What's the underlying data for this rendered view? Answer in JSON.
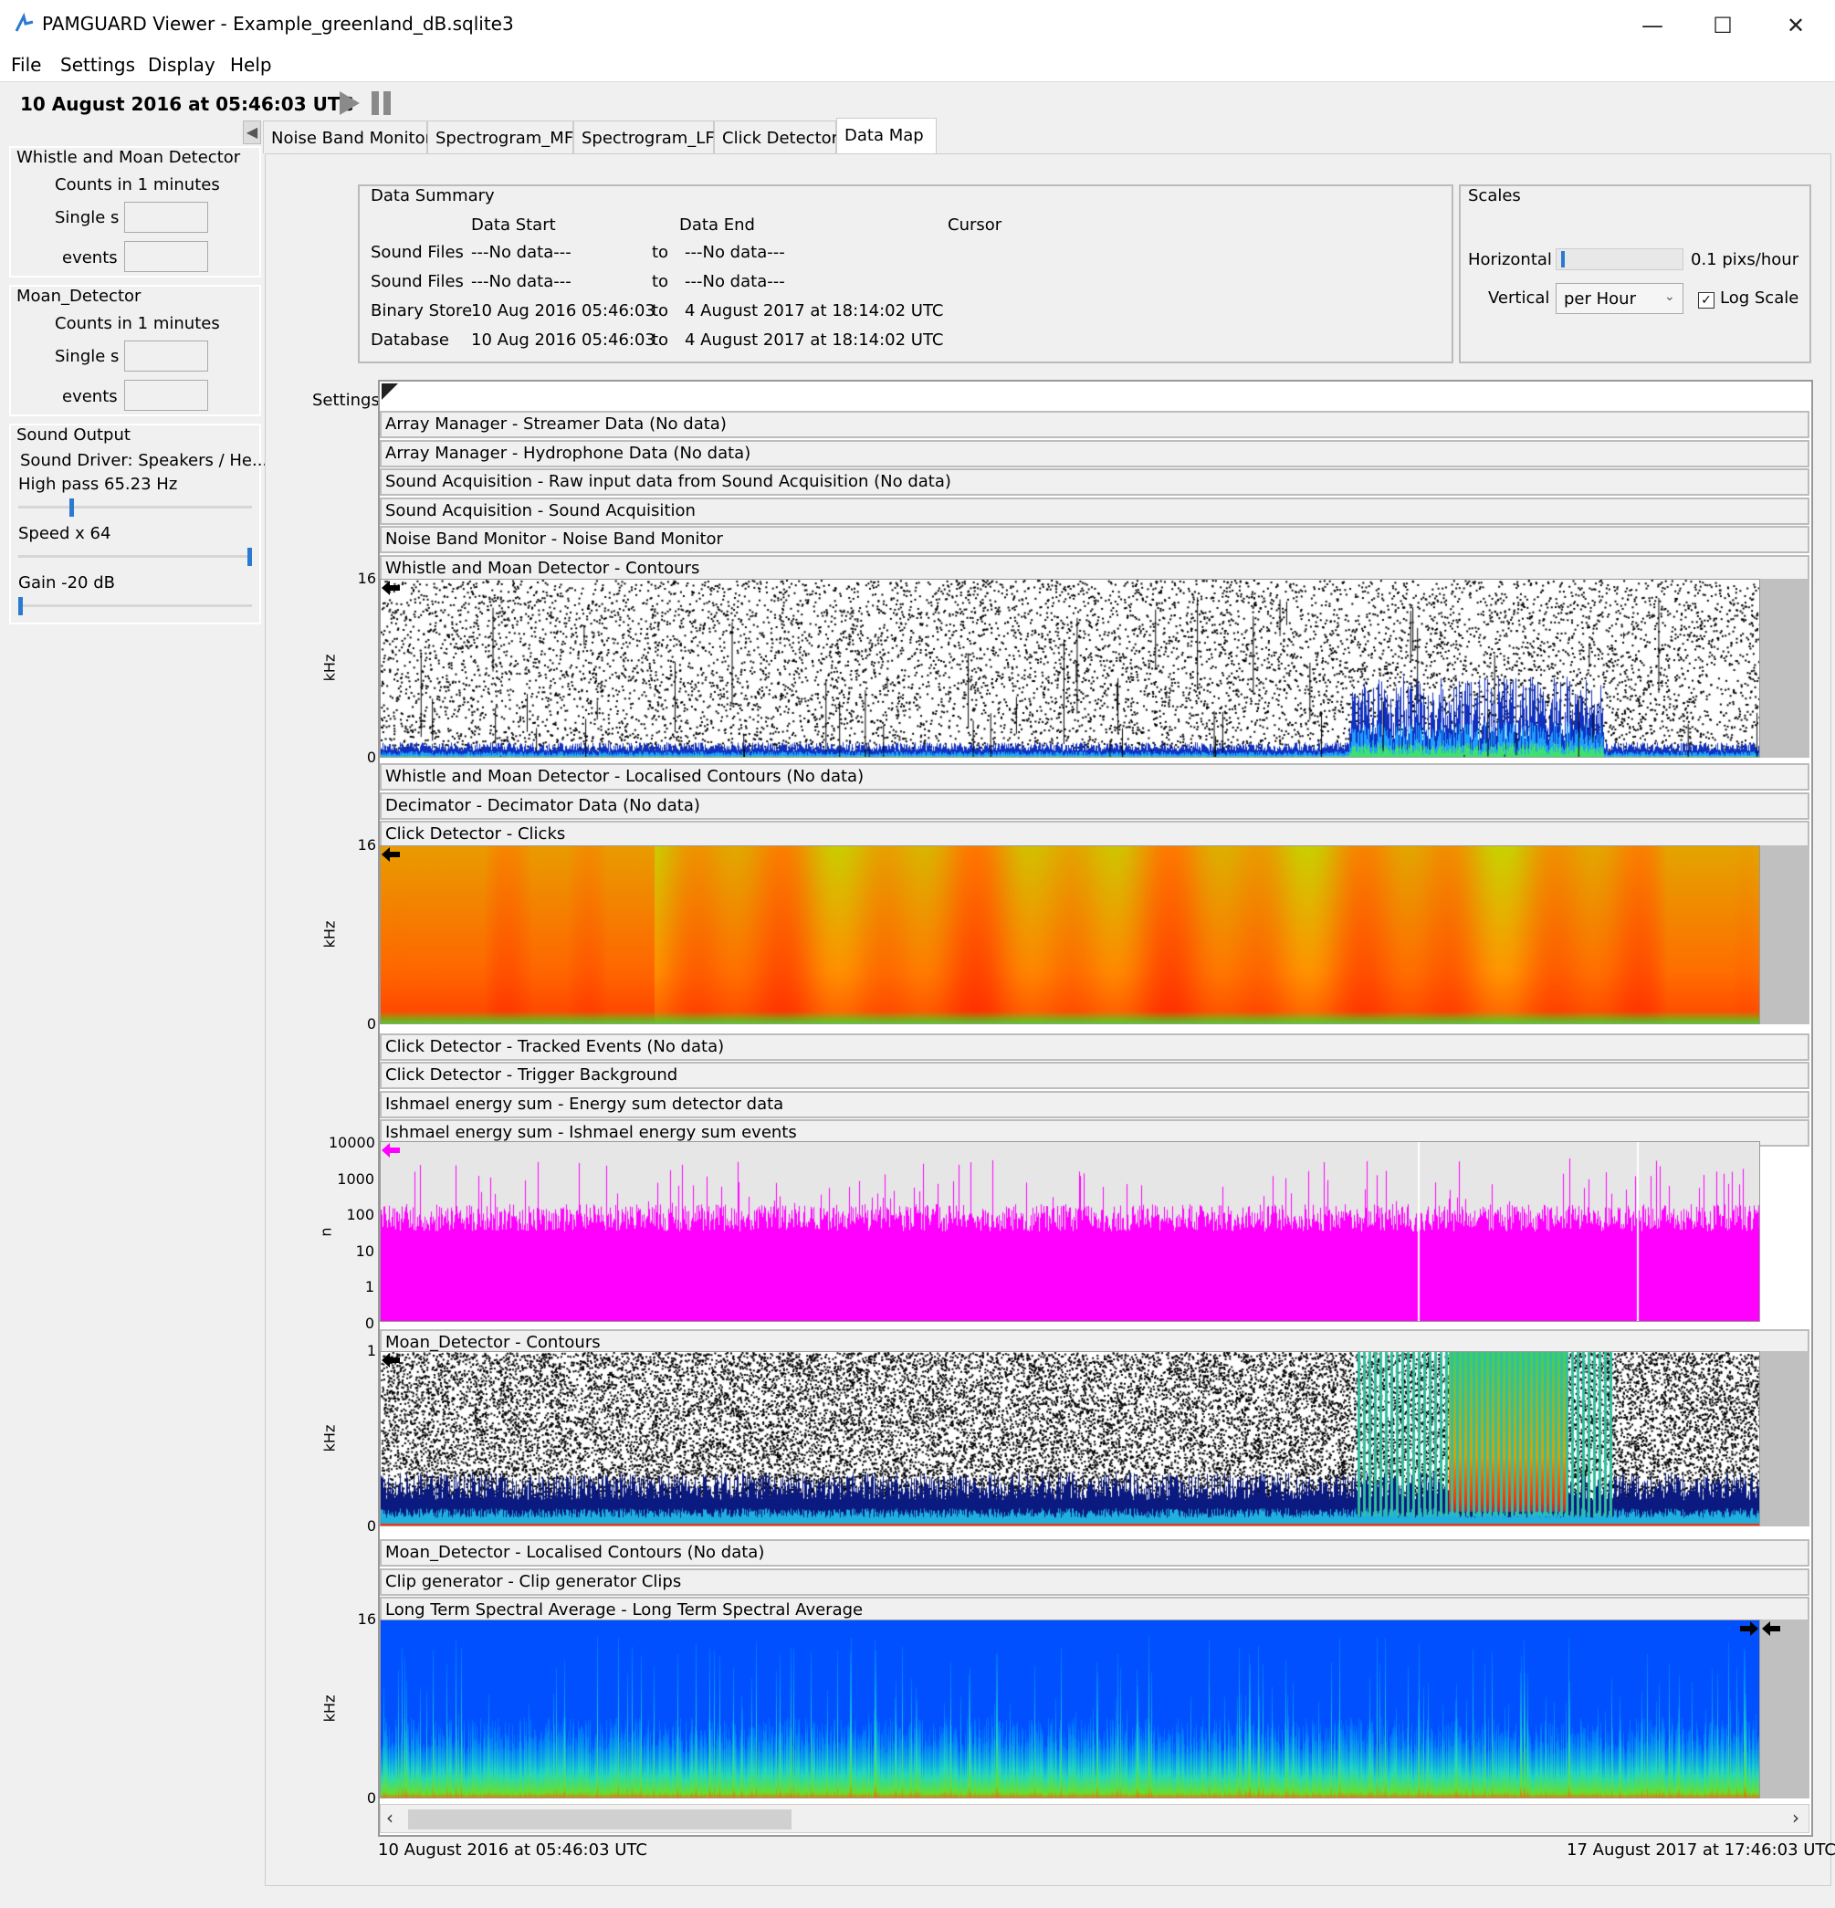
{
  "window": {
    "title": "PAMGUARD Viewer - Example_greenland_dB.sqlite3",
    "minimize": "—",
    "maximize": "☐",
    "close": "✕"
  },
  "menu": [
    "File",
    "Settings",
    "Display",
    "Help"
  ],
  "toolbar": {
    "time": "10 August 2016 at 05:46:03 UTC"
  },
  "left": {
    "wmd": {
      "title": "Whistle and Moan Detector",
      "counts": "Counts in 1 minutes",
      "single": "Single s",
      "events": "events"
    },
    "moan": {
      "title": "Moan_Detector",
      "counts": "Counts in 1 minutes",
      "single": "Single s",
      "events": "events"
    },
    "sound": {
      "title": "Sound Output",
      "driver": "Sound Driver: Speakers / He...",
      "highpass": "High pass 65.23 Hz",
      "speed": "Speed  x 64",
      "gain": "Gain -20 dB",
      "highpass_level": 0.22,
      "speed_level": 1.0,
      "gain_level": 0.0
    }
  },
  "tabs": [
    "Noise Band Monitor",
    "Spectrogram_MF",
    "Spectrogram_LF",
    "Click Detector",
    "Data Map"
  ],
  "summary": {
    "title": "Data Summary",
    "col_start": "Data Start",
    "col_end": "Data End",
    "col_cursor": "Cursor",
    "rows": [
      {
        "name": "Sound Files",
        "start": "---No data---",
        "to": "to",
        "end": "---No data---"
      },
      {
        "name": "Sound Files",
        "start": "---No data---",
        "to": "to",
        "end": "---No data---"
      },
      {
        "name": "Binary Store",
        "start": "10 Aug 2016 05:46:03",
        "to": "to",
        "end": "4 August 2017 at 18:14:02 UTC"
      },
      {
        "name": "Database",
        "start": "10 Aug 2016 05:46:03",
        "to": "to",
        "end": "4 August 2017 at 18:14:02 UTC"
      }
    ]
  },
  "scales": {
    "title": "Scales",
    "horizontal": "Horizontal",
    "hvalue": "0.1 pixs/hour",
    "vertical": "Vertical",
    "vselect": "per Hour",
    "logscale": "Log Scale",
    "hlevel": 0.02
  },
  "settings_label": "Settings",
  "strips": [
    "Array Manager - Streamer Data  (No data)",
    "Array Manager - Hydrophone Data  (No data)",
    "Sound Acquisition - Raw input data from Sound Acquisition  (No data)",
    "Sound Acquisition - Sound Acquisition",
    "Noise Band Monitor - Noise Band Monitor",
    "Whistle and Moan Detector - Contours",
    "Whistle and Moan Detector - Localised Contours  (No data)",
    "Decimator - Decimator Data  (No data)",
    "Click Detector - Clicks",
    "Click Detector - Tracked Events  (No data)",
    "Click Detector - Trigger Background",
    "Ishmael energy sum - Energy sum detector data",
    "Ishmael energy sum - Ishmael energy sum events",
    "Moan_Detector - Contours",
    "Moan_Detector - Localised Contours  (No data)",
    "Clip generator - Clip generator Clips",
    "Long Term Spectral Average - Long Term Spectral Average"
  ],
  "plots": {
    "wmd": {
      "top": "16",
      "bottom": "0",
      "unit": "kHz"
    },
    "clicks": {
      "top": "16",
      "bottom": "0",
      "unit": "kHz"
    },
    "ishmael": {
      "ticks": [
        "10000",
        "1000",
        "100",
        "10",
        "1",
        "0"
      ],
      "unit": "n"
    },
    "moan": {
      "top": "1",
      "bottom": "0",
      "unit": "kHz"
    },
    "ltsa": {
      "top": "16",
      "bottom": "0",
      "unit": "kHz"
    }
  },
  "timeline": {
    "start": "10 August 2016 at 05:46:03 UTC",
    "end": "17 August 2017 at 17:46:03 UTC"
  },
  "colors": {
    "magenta": "#ff00ff",
    "ltsa_blue": "#0050ff",
    "clicks_orange": "#ff7a00"
  }
}
